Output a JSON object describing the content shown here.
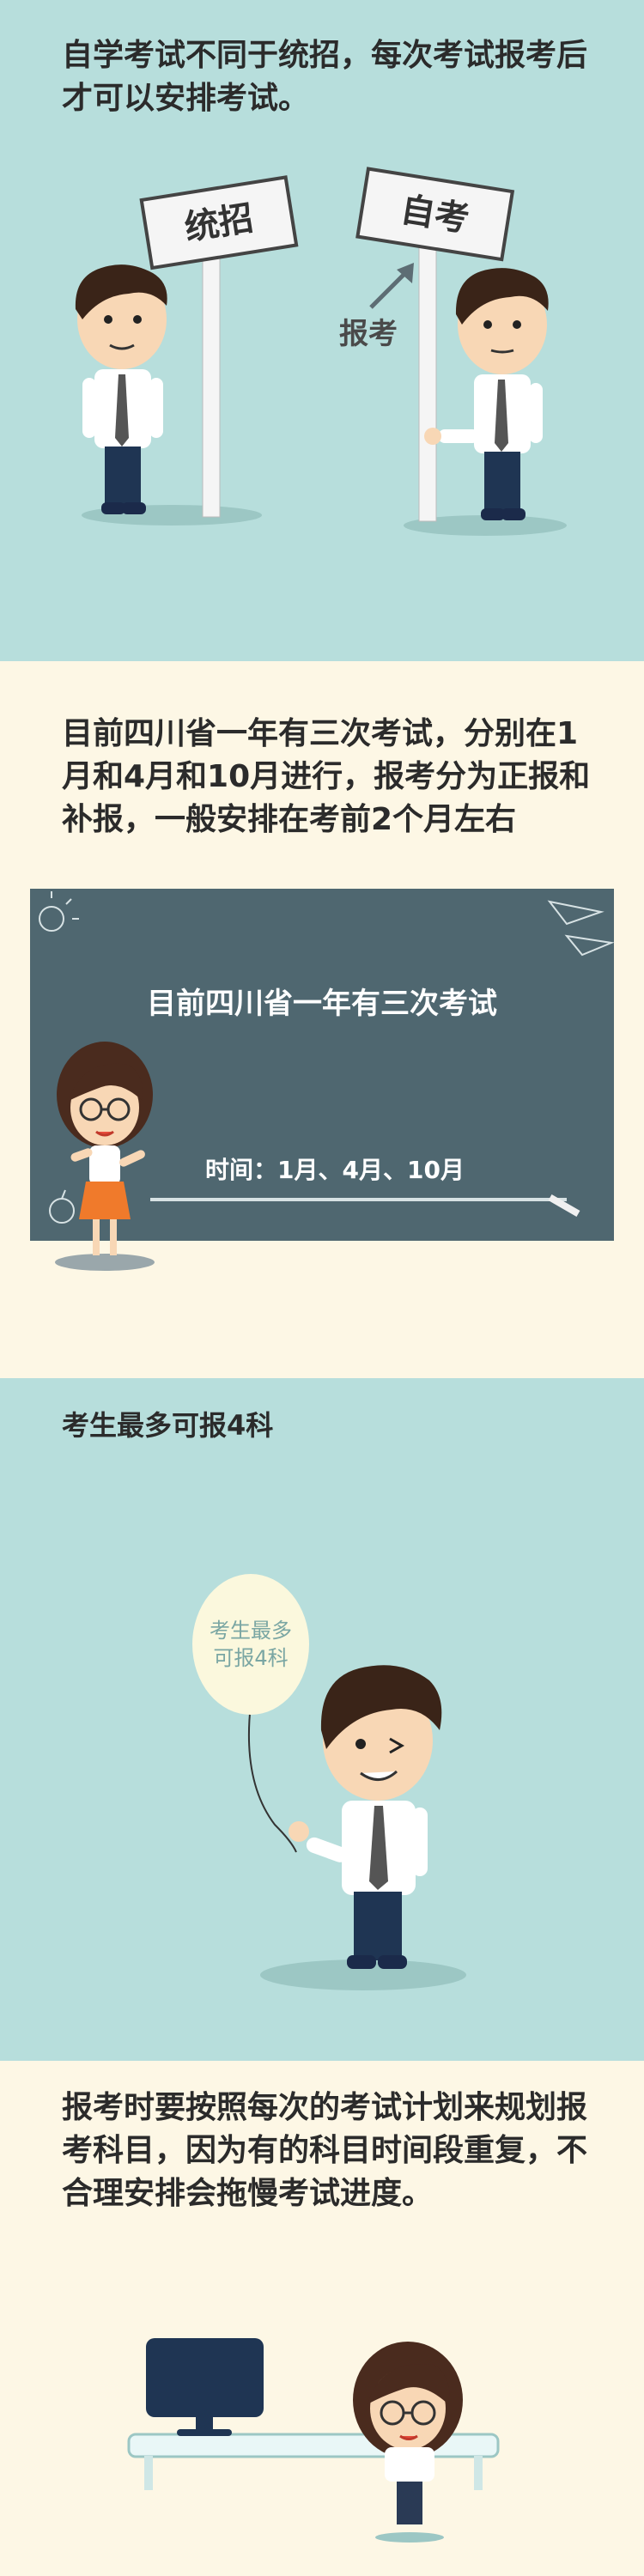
{
  "panel1": {
    "heading": "自学考试不同于统招，每次考试报考后才可以安排考试。",
    "sign_left": "统招",
    "sign_right": "自考",
    "arrow_label": "报考"
  },
  "panel2": {
    "heading": "目前四川省一年有三次考试，分别在1月和4月和10月进行，报考分为正报和补报，一般安排在考前2个月左右",
    "board_title": "目前四川省一年有三次考试",
    "board_time": "时间：1月、4月、10月"
  },
  "panel3": {
    "heading": "考生最多可报4科",
    "balloon_line1": "考生最多",
    "balloon_line2": "可报4科"
  },
  "panel4": {
    "heading": "报考时要按照每次的考试计划来规划报考科目，因为有的科目时间段重复，不合理安排会拖慢考试进度。"
  },
  "colors": {
    "mint": "#b7dedc",
    "cream": "#fdf7e5",
    "board": "#4f6770",
    "skirt": "#f07a2b",
    "hair": "#3a2418",
    "pants": "#1f3553"
  }
}
